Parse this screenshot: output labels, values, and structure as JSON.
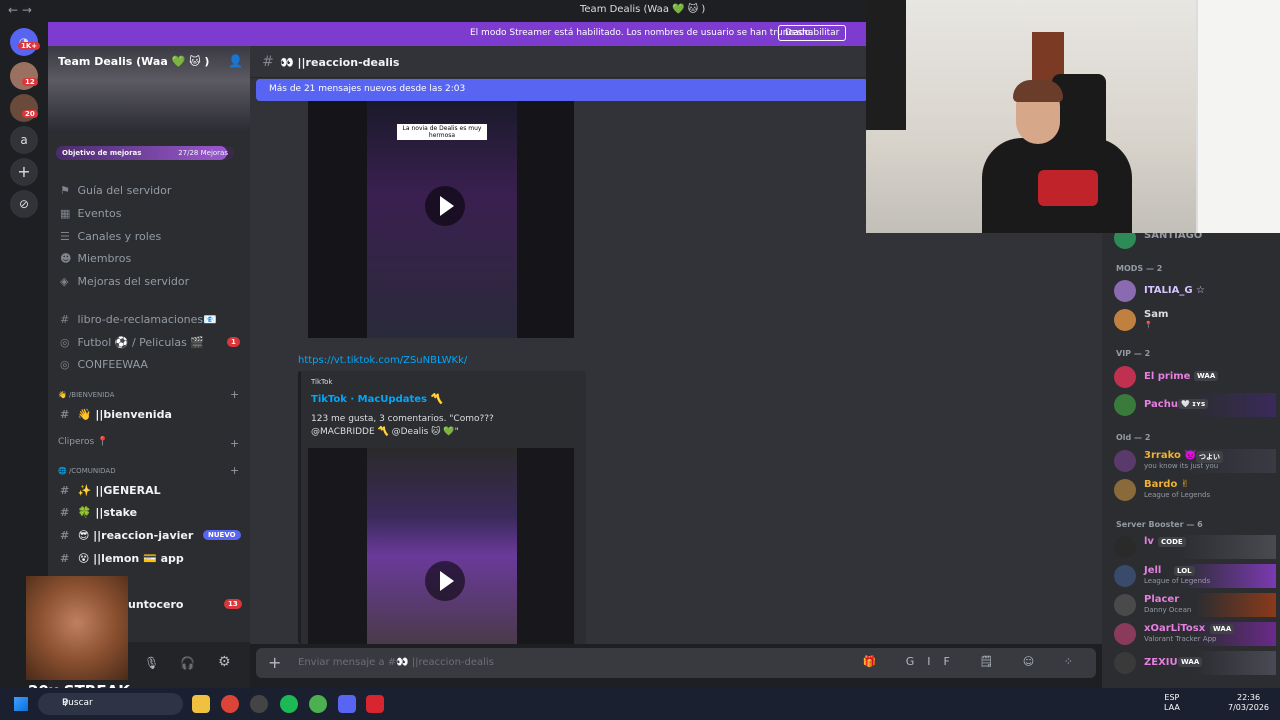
{
  "window": {
    "title": "Team Dealis (Waa 💚 🐱 )",
    "nav": "←  →"
  },
  "streamer_bar": {
    "message": "El modo Streamer está habilitado. Los nombres de usuario se han truncado.",
    "button": "Deshabilitar"
  },
  "rail": {
    "badge1": "1K+",
    "badge2": "12",
    "badge3": "20",
    "letter": "a",
    "add": "+",
    "explore": "⊘"
  },
  "server": {
    "name": "Team Dealis (Waa 💚 🐱 )",
    "boost_goal": "Objetivo de mejoras",
    "boost_count": "27/28 Mejoras",
    "boost_fraction": 0.964
  },
  "sidebar": {
    "nav": [
      "Guía del servidor",
      "Eventos",
      "Canales y roles",
      "Miembros",
      "Mejoras del servidor"
    ],
    "channels_top": [
      {
        "label": "libro-de-reclamaciones📧"
      },
      {
        "label": "Futbol ⚽ / Peliculas 🎬",
        "badge": "1"
      },
      {
        "label": "CONFEEWAA"
      }
    ],
    "cat_bienvenida": "👋 /bienvenida",
    "bienvenida": "👋 ||bienvenida",
    "cat_clipers": "Cliperos 📍",
    "cat_comunidad": "🌐 /comunidad",
    "comunidad": [
      {
        "label": "✨ ||GENERAL"
      },
      {
        "label": "🍀 ||stake"
      },
      {
        "label": "😎 ||reaccion-javier",
        "tag": "NUEVO"
      },
      {
        "label": "😵 ||lemon 💳 app"
      }
    ],
    "puntocero": "untocero",
    "puntocero_badge": "13",
    "streak": "20x STREAK"
  },
  "channel": {
    "name": "👀 ||reaccion-dealis",
    "new_messages": "Más de 21 mensajes nuevos desde las 2:03"
  },
  "messages": {
    "video1_caption": "La novia de Dealis es muy hermosa",
    "link": "https://vt.tiktok.com/ZSuNBLWKk/",
    "embed_provider": "TikTok",
    "embed_title": "TikTok · MacUpdates 〽️",
    "embed_desc": "123 me gusta, 3 comentarios. \"Como??? @MACBRIDDE 〽️ @Dealis 🐱 💚\""
  },
  "input": {
    "placeholder": "Enviar mensaje a #👀 ||reaccion-dealis",
    "tools": "🎁 GIF 🗒 ☺ ⁘"
  },
  "members": {
    "top_name": "SANTIAGO",
    "cat_mods": "MODS — 2",
    "mods": [
      {
        "name": "ITALIA_G ☆",
        "color": "#d8c3ff"
      },
      {
        "name": "Sam",
        "color": "#dbdee1",
        "sub": "📍"
      }
    ],
    "cat_vip": "VIP — 2",
    "vip": [
      {
        "name": "El prime",
        "tag": "WAA",
        "color": "#e57fe0"
      },
      {
        "name": "Pachu",
        "tag": "🤍 ɪʏꜱ",
        "color": "#e57fe0"
      }
    ],
    "cat_old": "Old — 2",
    "old": [
      {
        "name": "3rrako 👿",
        "tag": "つよい",
        "sub": "you know its just you",
        "color": "#f0b232"
      },
      {
        "name": "Bardo ✌",
        "sub": "League of Legends",
        "color": "#f0b232"
      }
    ],
    "cat_booster": "Server Booster — 6",
    "boosters": [
      {
        "name": "lv",
        "tag": "CODE",
        "color": "#e57fe0"
      },
      {
        "name": "Jell",
        "tag": "LOL",
        "sub": "League of Legends",
        "color": "#e57fe0"
      },
      {
        "name": "Placer",
        "sub": "Danny Ocean",
        "color": "#e57fe0"
      },
      {
        "name": "xOarLiTosx",
        "tag": "WAA",
        "sub": "Valorant Tracker App",
        "color": "#e57fe0"
      },
      {
        "name": "ZEXIU",
        "tag": "WAA",
        "color": "#e57fe0"
      }
    ]
  },
  "taskbar": {
    "search": "Buscar",
    "lang1": "ESP",
    "lang2": "LAA",
    "time": "22:36",
    "date": "7/03/2026"
  }
}
